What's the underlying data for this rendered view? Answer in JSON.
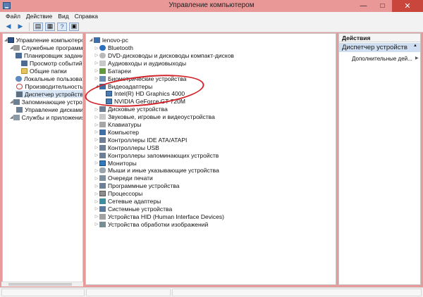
{
  "window": {
    "title": "Управление компьютером",
    "controls": {
      "minimize": "—",
      "maximize": "□",
      "close": "✕"
    }
  },
  "menubar": {
    "items": [
      "Файл",
      "Действие",
      "Вид",
      "Справка"
    ]
  },
  "toolbar": {
    "buttons": [
      "back-icon",
      "forward-icon",
      "up-icon",
      "show-hide-tree-icon",
      "help-icon",
      "properties-icon"
    ]
  },
  "left_tree": {
    "items": [
      {
        "label": "Управление компьютером (л",
        "icon": "computer-management-icon",
        "level": 0
      },
      {
        "label": "Служебные программы",
        "icon": "tools-icon",
        "level": 1
      },
      {
        "label": "Планировщик заданий",
        "icon": "task-scheduler-icon",
        "level": 2
      },
      {
        "label": "Просмотр событий",
        "icon": "event-viewer-icon",
        "level": 2
      },
      {
        "label": "Общие папки",
        "icon": "shared-folder-icon",
        "level": 2
      },
      {
        "label": "Локальные пользовате",
        "icon": "users-icon",
        "level": 2
      },
      {
        "label": "Производительность",
        "icon": "performance-icon",
        "level": 2
      },
      {
        "label": "Диспетчер устройств",
        "icon": "device-manager-icon",
        "level": 2,
        "selected": true
      },
      {
        "label": "Запоминающие устройст",
        "icon": "storage-icon",
        "level": 1
      },
      {
        "label": "Управление дисками",
        "icon": "disk-management-icon",
        "level": 2
      },
      {
        "label": "Службы и приложения",
        "icon": "services-icon",
        "level": 1
      }
    ]
  },
  "device_tree": {
    "root": "lenovo-pc",
    "items": [
      {
        "label": "Bluetooth",
        "icon": "bluetooth-icon"
      },
      {
        "label": "DVD-дисководы и дисководы компакт-дисков",
        "icon": "dvd-icon"
      },
      {
        "label": "Аудиовходы и аудиовыходы",
        "icon": "audio-icon"
      },
      {
        "label": "Батареи",
        "icon": "battery-icon"
      },
      {
        "label": "Биометрические устройства",
        "icon": "biometric-icon"
      },
      {
        "label": "Видеоадаптеры",
        "icon": "display-adapter-icon",
        "expanded": true,
        "children": [
          "Intel(R) HD Graphics 4000",
          "NVIDIA GeForce GT 720M"
        ]
      },
      {
        "label": "Дисковые устройства",
        "icon": "disk-drive-icon"
      },
      {
        "label": "Звуковые, игровые и видеоустройства",
        "icon": "sound-icon"
      },
      {
        "label": "Клавиатуры",
        "icon": "keyboard-icon"
      },
      {
        "label": "Компьютер",
        "icon": "computer-icon"
      },
      {
        "label": "Контроллеры IDE ATA/ATAPI",
        "icon": "ide-controller-icon"
      },
      {
        "label": "Контроллеры USB",
        "icon": "usb-controller-icon"
      },
      {
        "label": "Контроллеры запоминающих устройств",
        "icon": "storage-controller-icon"
      },
      {
        "label": "Мониторы",
        "icon": "monitor-icon"
      },
      {
        "label": "Мыши и иные указывающие устройства",
        "icon": "mouse-icon"
      },
      {
        "label": "Очереди печати",
        "icon": "print-queue-icon"
      },
      {
        "label": "Программные устройства",
        "icon": "software-device-icon"
      },
      {
        "label": "Процессоры",
        "icon": "processor-icon"
      },
      {
        "label": "Сетевые адаптеры",
        "icon": "network-adapter-icon"
      },
      {
        "label": "Системные устройства",
        "icon": "system-device-icon"
      },
      {
        "label": "Устройства HID (Human Interface Devices)",
        "icon": "hid-icon"
      },
      {
        "label": "Устройства обработки изображений",
        "icon": "imaging-device-icon"
      }
    ]
  },
  "actions": {
    "header": "Действия",
    "section": "Диспетчер устройств",
    "items": [
      "Дополнительные дей..."
    ]
  },
  "colors": {
    "annotation": "#d2242a",
    "selection": "#d9e7f7",
    "title_bg": "#e99797"
  }
}
